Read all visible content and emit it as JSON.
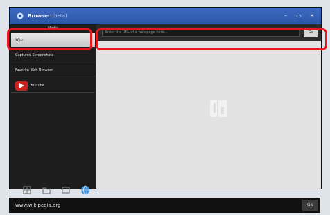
{
  "window": {
    "app_title": "Browser",
    "app_subtitle": "(beta)",
    "controls": [
      "minimize",
      "maximize",
      "close"
    ]
  },
  "sidebar": {
    "header": "Media",
    "items": [
      {
        "label": "Web"
      },
      {
        "label": "Captured Screenshots"
      },
      {
        "label": "Favorite Web Browser"
      },
      {
        "label": "Youtube",
        "icon": "youtube-icon"
      }
    ],
    "tools": [
      "grid-icon",
      "folder-icon",
      "window-icon",
      "globe-icon"
    ]
  },
  "main": {
    "url_placeholder": "Enter the URL of a web page here...",
    "go_label": "Go",
    "center_icon": "placeholder-logo-icon"
  },
  "bottom_bar": {
    "url_text": "www.wikipedia.org",
    "go_label": "Go"
  },
  "colors": {
    "title_bar": "#3a65bb",
    "highlight": "#e8161e",
    "sidebar_bg": "#1d1d1d",
    "content_bg": "#e2e2e2"
  }
}
